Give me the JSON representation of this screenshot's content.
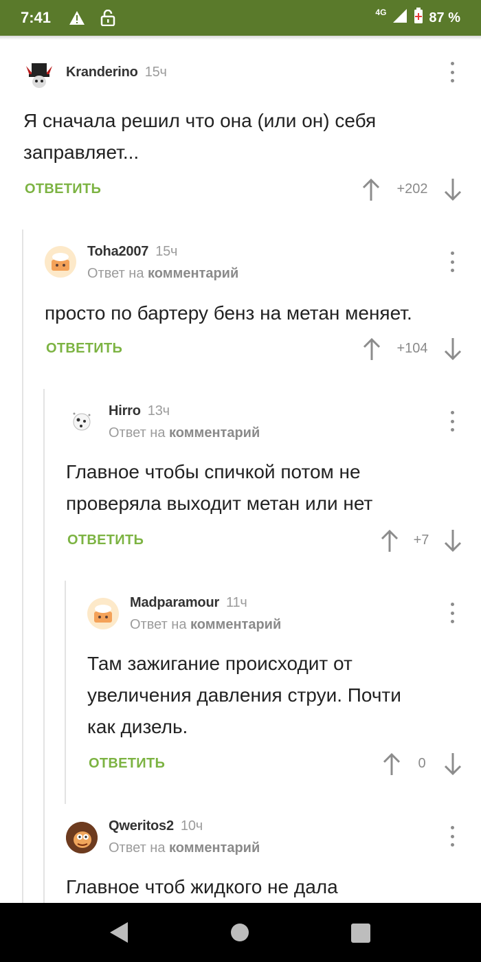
{
  "status_bar": {
    "time": "7:41",
    "network": "4G",
    "battery": "87 %",
    "icons": [
      "warning-icon",
      "unlock-icon",
      "signal-icon",
      "battery-icon"
    ]
  },
  "colors": {
    "status_bar_bg": "#5a7a2b",
    "reply_green": "#7cb342",
    "meta_gray": "#9b9b9b"
  },
  "comments": [
    {
      "author": "Kranderino",
      "time": "15ч",
      "reply_prefix": "",
      "reply_link": "",
      "text_lines": [
        "Я сначала решил что она (или он) себя",
        "заправляет..."
      ],
      "reply_label": "ОТВЕТИТЬ",
      "score": "+202"
    },
    {
      "author": "Toha2007",
      "time": "15ч",
      "reply_prefix": "Ответ на",
      "reply_link": "комментарий",
      "text_lines": [
        "просто по бартеру бенз на метан меняет."
      ],
      "reply_label": "ОТВЕТИТЬ",
      "score": "+104"
    },
    {
      "author": "Hirro",
      "time": "13ч",
      "reply_prefix": "Ответ на",
      "reply_link": "комментарий",
      "text_lines": [
        "Главное чтобы спичкой потом не",
        "проверяла выходит метан или нет"
      ],
      "reply_label": "ОТВЕТИТЬ",
      "score": "+7"
    },
    {
      "author": "Madparamour",
      "time": "11ч",
      "reply_prefix": "Ответ на",
      "reply_link": "комментарий",
      "text_lines": [
        "Там зажигание происходит от",
        "увеличения давления струи. Почти",
        "как дизель."
      ],
      "reply_label": "ОТВЕТИТЬ",
      "score": "0"
    },
    {
      "author": "Qweritos2",
      "time": "10ч",
      "reply_prefix": "Ответ на",
      "reply_link": "комментарий",
      "text_lines": [
        "Главное чтоб жидкого не дала"
      ],
      "reply_label": "",
      "score": ""
    }
  ],
  "nav_bar": {
    "icons": [
      "back-icon",
      "home-icon",
      "recents-icon"
    ]
  }
}
